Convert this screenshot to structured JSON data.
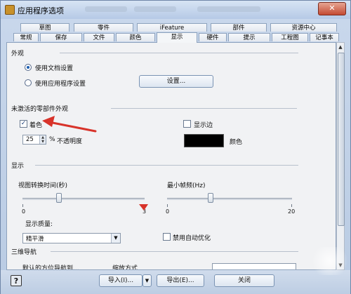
{
  "window": {
    "title": "应用程序选项",
    "close_label": "✕"
  },
  "tabs_back": [
    "草图",
    "零件",
    "iFeature",
    "部件",
    "资源中心"
  ],
  "tabs_front": [
    "常规",
    "保存",
    "文件",
    "颜色",
    "显示",
    "硬件",
    "提示",
    "工程图",
    "记事本"
  ],
  "active_tab": "显示",
  "appearance": {
    "section_title": "外观",
    "use_doc_settings": "使用文档设置",
    "use_app_settings": "使用应用程序设置",
    "settings_button": "设置..."
  },
  "inactive": {
    "section_title": "未激活的零部件外观",
    "shading_label": "着色",
    "shading_checked": true,
    "show_edges_label": "显示边",
    "show_edges_checked": false,
    "opacity_value": "25",
    "opacity_unit": "%",
    "opacity_label": "不透明度",
    "color_label": "颜色",
    "color_hex": "#000000"
  },
  "display": {
    "section_title": "显示",
    "view_transition_label": "视图转换时间(秒)",
    "view_transition_min": "0",
    "view_transition_max": "3",
    "view_transition_value": 0.9,
    "min_fps_label": "最小帧频(Hz)",
    "min_fps_min": "0",
    "min_fps_max": "20",
    "min_fps_value": 7,
    "quality_label": "显示质量:",
    "quality_value": "精平滑",
    "disable_auto_label": "禁用自动优化",
    "disable_auto_checked": false
  },
  "nav3d": {
    "section_title": "三维导航",
    "sub_label_1": "默认的方位导航到...",
    "sub_label_2": "缩放方式"
  },
  "bottom": {
    "help_label": "?",
    "import_label": "导入(I)...",
    "export_label": "导出(E)...",
    "close_label": "关闭"
  },
  "colors": {
    "accent_arrow": "#d8332a",
    "panel_bg": "#f1f2f4"
  }
}
